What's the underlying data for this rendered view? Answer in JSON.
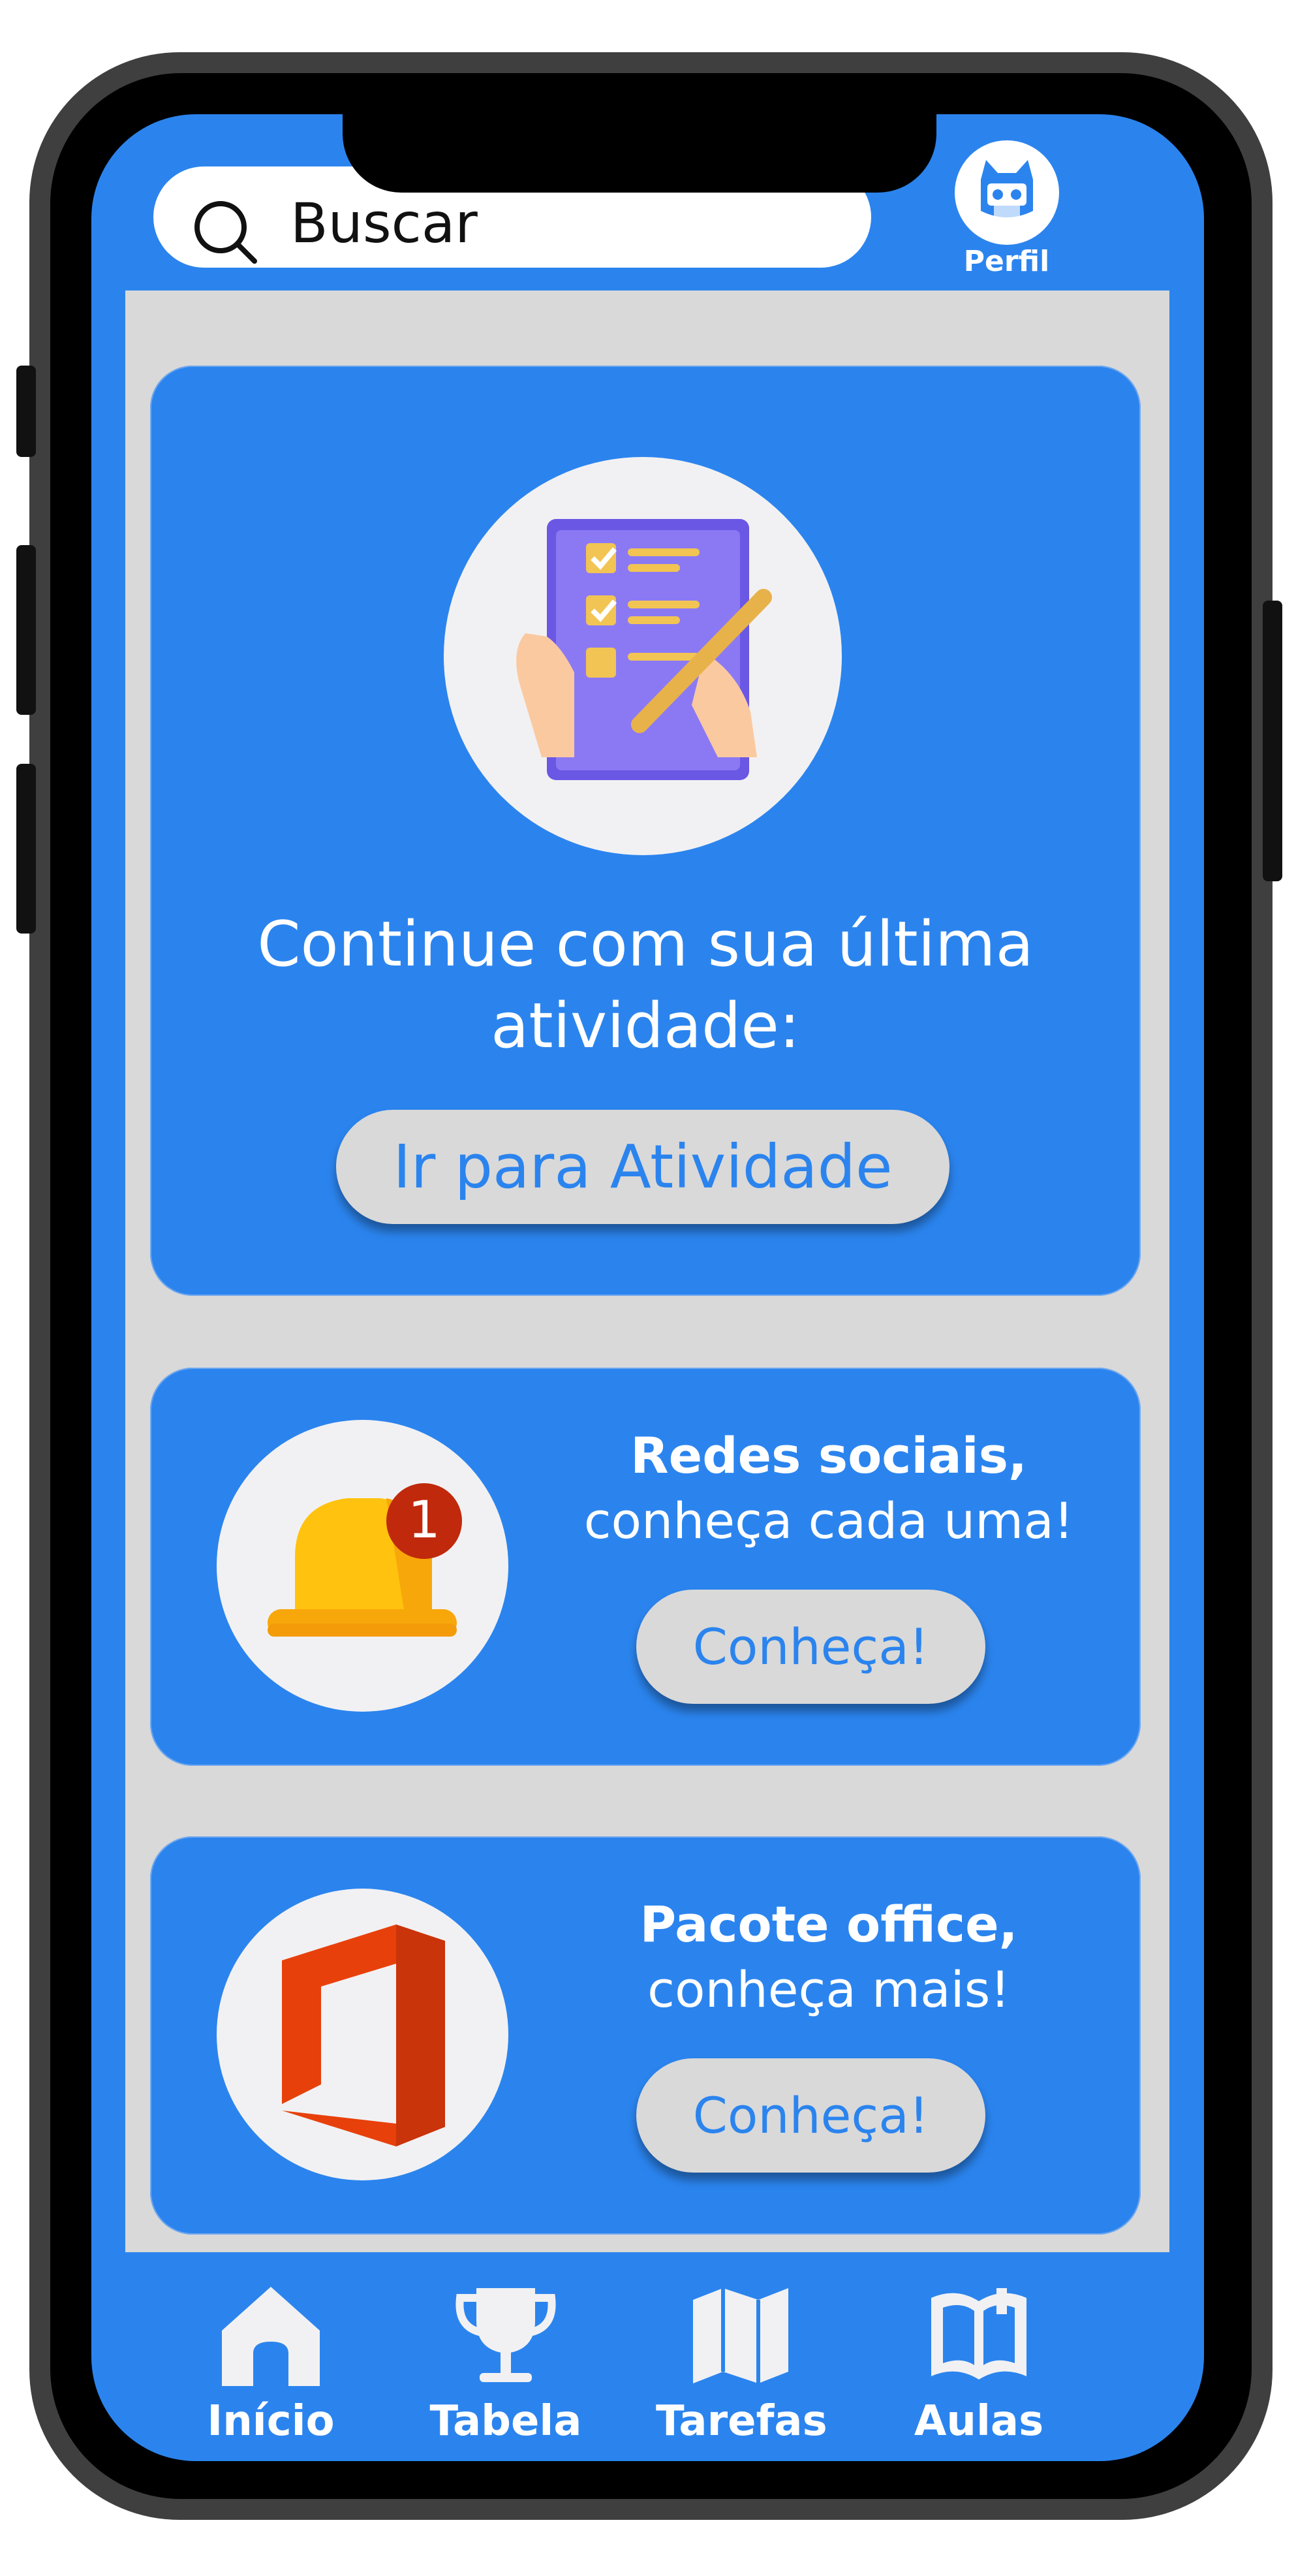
{
  "search": {
    "placeholder": "Buscar"
  },
  "profile": {
    "label": "Perfil"
  },
  "activity_card": {
    "title_line1": "Continue com sua última",
    "title_line2": "atividade:",
    "button_label": "Ir para Atividade"
  },
  "social_card": {
    "title": "Redes sociais,",
    "subtitle": "conheça cada uma!",
    "badge_count": "1",
    "button_label": "Conheça!"
  },
  "office_card": {
    "title": "Pacote office,",
    "subtitle": "conheça mais!",
    "button_label": "Conheça!"
  },
  "nav": {
    "items": [
      {
        "label": "Início",
        "icon": "home-icon"
      },
      {
        "label": "Tabela",
        "icon": "trophy-icon"
      },
      {
        "label": "Tarefas",
        "icon": "map-icon"
      },
      {
        "label": "Aulas",
        "icon": "book-icon"
      }
    ]
  },
  "colors": {
    "primary": "#2b84ee",
    "content_bg": "#d9d9d9",
    "phone_frame": "#3f3f3f",
    "office_orange": "#e8400b",
    "bell_yellow": "#ffc20e",
    "badge_red": "#c0290c",
    "clipboard_purple": "#7e6cf0"
  }
}
